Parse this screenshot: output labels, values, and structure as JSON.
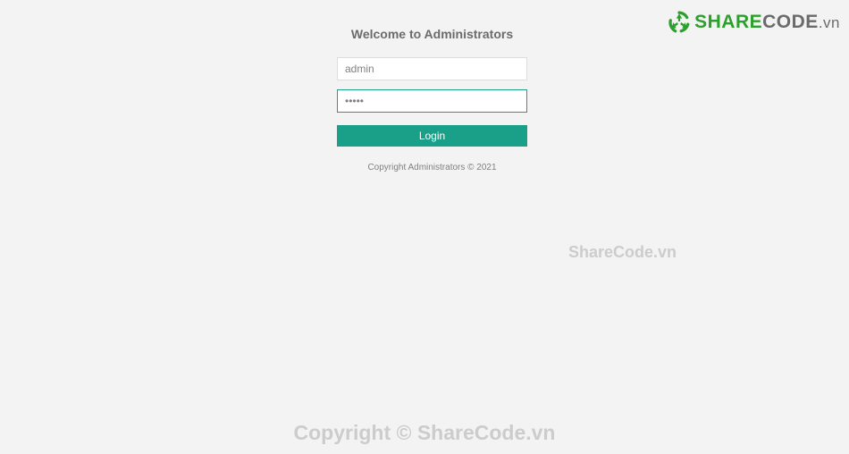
{
  "logo": {
    "share": "SHARE",
    "code": "CODE",
    "vn": ".vn"
  },
  "login": {
    "title": "Welcome to Administrators",
    "username_value": "admin",
    "password_value": "•••••",
    "button_label": "Login",
    "copyright": "Copyright Administrators © 2021"
  },
  "watermark": {
    "center": "ShareCode.vn",
    "bottom": "Copyright © ShareCode.vn"
  },
  "colors": {
    "button_bg": "#1aa089",
    "logo_green": "#2ca02c",
    "page_bg": "#f3f3f3"
  }
}
